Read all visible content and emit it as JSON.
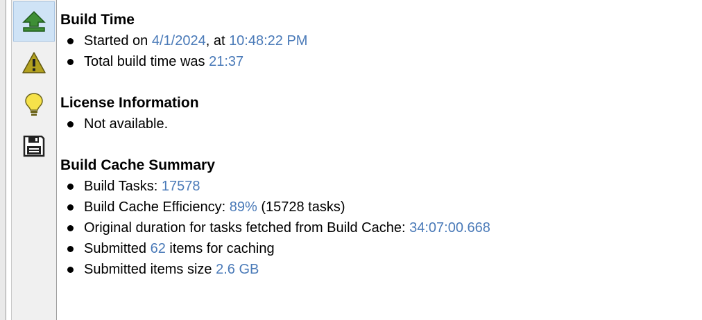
{
  "sidebar": {
    "items": [
      {
        "icon": "upload-arrow-icon",
        "selected": true
      },
      {
        "icon": "warning-icon",
        "selected": false
      },
      {
        "icon": "lightbulb-icon",
        "selected": false
      },
      {
        "icon": "floppy-disk-icon",
        "selected": false
      }
    ]
  },
  "colors": {
    "value_link": "#4a7ab8",
    "selected_bg": "#cfe3f6"
  },
  "sections": {
    "build_time": {
      "title": "Build Time",
      "started_prefix": "Started on ",
      "started_date": "4/1/2024",
      "started_mid": ", at ",
      "started_time": "10:48:22 PM",
      "total_prefix": "Total build time was ",
      "total_value": "21:37"
    },
    "license": {
      "title": "License Information",
      "status": "Not available."
    },
    "cache": {
      "title": "Build Cache Summary",
      "tasks_prefix": "Build Tasks: ",
      "tasks_value": "17578",
      "efficiency_prefix": "Build Cache Efficiency: ",
      "efficiency_value": "89%",
      "efficiency_suffix": " (15728 tasks)",
      "duration_prefix": "Original duration for tasks fetched from Build Cache: ",
      "duration_value": "34:07:00.668",
      "submitted_prefix": "Submitted ",
      "submitted_value": "62",
      "submitted_suffix": " items for caching",
      "size_prefix": "Submitted items size ",
      "size_value": "2.6 GB"
    }
  }
}
